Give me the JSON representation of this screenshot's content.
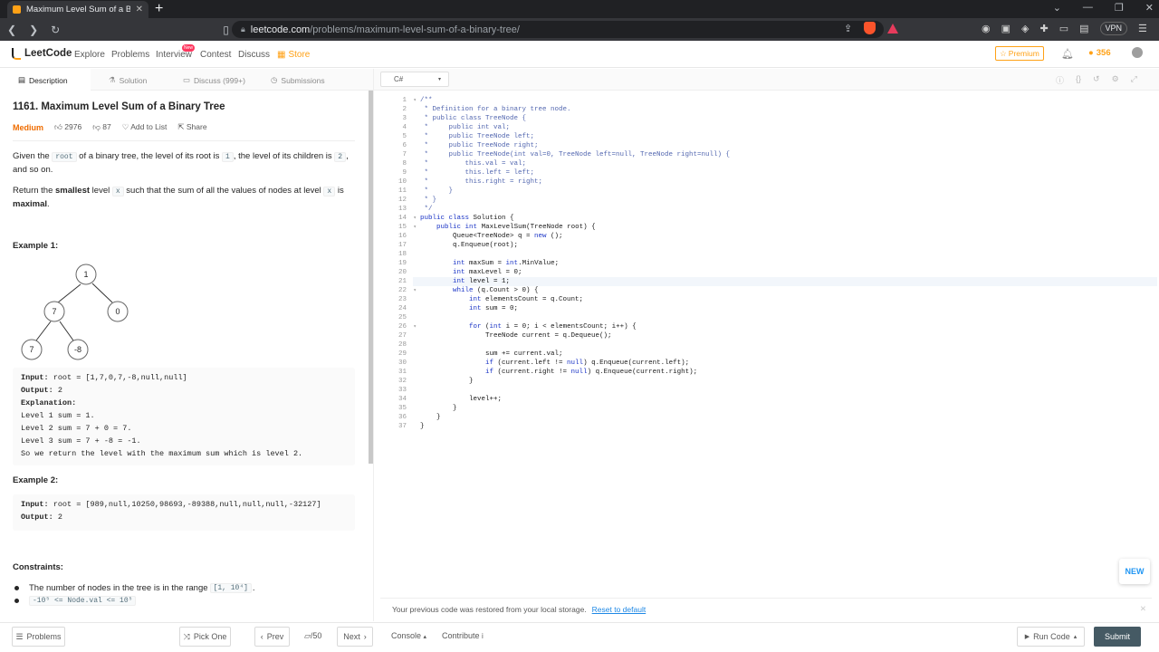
{
  "browser": {
    "tab_title": "Maximum Level Sum of a Binary",
    "new_tab": "+",
    "url_host": "leetcode.com",
    "url_path": "/problems/maximum-level-sum-of-a-binary-tree/",
    "vpn": "VPN"
  },
  "nav": {
    "logo": "LeetCode",
    "links": [
      "Explore",
      "Problems",
      "Interview",
      "Contest",
      "Discuss"
    ],
    "new_badge": "New",
    "store": "Store",
    "premium": "Premium",
    "streak": "356"
  },
  "left_tabs": [
    "Description",
    "Solution",
    "Discuss (999+)",
    "Submissions"
  ],
  "problem": {
    "title": "1161. Maximum Level Sum of a Binary Tree",
    "difficulty": "Medium",
    "likes": "2976",
    "dislikes": "87",
    "add_to_list": "Add to List",
    "share": "Share",
    "desc1_a": "Given the ",
    "desc1_code1": "root",
    "desc1_b": " of a binary tree, the level of its root is ",
    "desc1_code2": "1",
    "desc1_c": ", the level of its children is ",
    "desc1_code3": "2",
    "desc1_d": ", and so on.",
    "desc2_a": "Return the ",
    "desc2_bold1": "smallest",
    "desc2_b": " level ",
    "desc2_code1": "x",
    "desc2_c": " such that the sum of all the values of nodes at level ",
    "desc2_code2": "x",
    "desc2_d": " is ",
    "desc2_bold2": "maximal",
    "desc2_e": ".",
    "example1_title": "Example 1:",
    "tree_nodes": [
      "1",
      "7",
      "0",
      "7",
      "-8"
    ],
    "example1": {
      "input_label": "Input:",
      "input": "root = [1,7,0,7,-8,null,null]",
      "output_label": "Output:",
      "output": "2",
      "explanation_label": "Explanation:",
      "lines": [
        "Level 1 sum = 1.",
        "Level 2 sum = 7 + 0 = 7.",
        "Level 3 sum = 7 + -8 = -1.",
        "So we return the level with the maximum sum which is level 2."
      ]
    },
    "example2_title": "Example 2:",
    "example2": {
      "input_label": "Input:",
      "input": "root = [989,null,10250,98693,-89388,null,null,null,-32127]",
      "output_label": "Output:",
      "output": "2"
    },
    "constraints_title": "Constraints:",
    "constraint1_text": "The number of nodes in the tree is in the range ",
    "constraint1_code": "[1, 10⁴]",
    "constraint1_end": ".",
    "constraint2_code": "-10⁵ <= Node.val <= 10⁵"
  },
  "editor": {
    "language": "C#",
    "active_line": 21,
    "fold_lines": [
      1,
      14,
      15,
      22,
      26
    ],
    "code": [
      "/**",
      " * Definition for a binary tree node.",
      " * public class TreeNode {",
      " *     public int val;",
      " *     public TreeNode left;",
      " *     public TreeNode right;",
      " *     public TreeNode(int val=0, TreeNode left=null, TreeNode right=null) {",
      " *         this.val = val;",
      " *         this.left = left;",
      " *         this.right = right;",
      " *     }",
      " * }",
      " */",
      "public class Solution {",
      "    public int MaxLevelSum(TreeNode root) {",
      "        Queue<TreeNode> q = new ();",
      "        q.Enqueue(root);",
      "",
      "        int maxSum = int.MinValue;",
      "        int maxLevel = 0;",
      "        int level = 1;",
      "        while (q.Count > 0) {",
      "            int elementsCount = q.Count;",
      "            int sum = 0;",
      "",
      "            for (int i = 0; i < elementsCount; i++) {",
      "                TreeNode current = q.Dequeue();",
      "",
      "                sum += current.val;",
      "                if (current.left != null) q.Enqueue(current.left);",
      "                if (current.right != null) q.Enqueue(current.right);",
      "            }",
      "",
      "            level++;",
      "        }",
      "    }",
      "}"
    ],
    "restored_msg": "Your previous code was restored from your local storage.",
    "reset_link": "Reset to default",
    "new_button": "NEW"
  },
  "bottom": {
    "problems": "Problems",
    "pick_one": "Pick One",
    "prev": "Prev",
    "page": "/50",
    "next": "Next",
    "console": "Console",
    "contribute": "Contribute",
    "run_code": "Run Code",
    "submit": "Submit"
  }
}
